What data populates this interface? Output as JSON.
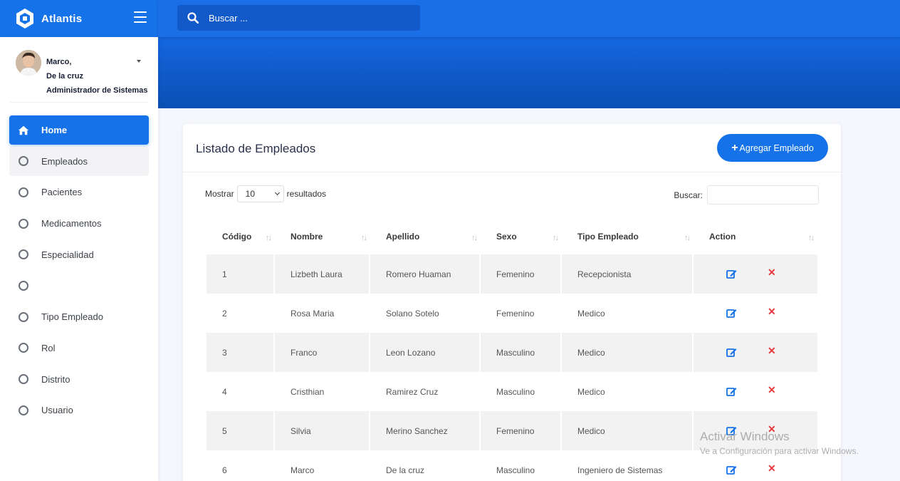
{
  "app": {
    "name": "Atlantis"
  },
  "topbar": {
    "search_placeholder": "Buscar ..."
  },
  "user": {
    "line1": "Marco,",
    "line2": "De la cruz",
    "line3": "Administrador de Sistemas"
  },
  "sidebar": {
    "items": [
      {
        "label": "Home",
        "icon": "home-icon",
        "state": "active"
      },
      {
        "label": "Empleados",
        "icon": "ring-icon",
        "state": "hover"
      },
      {
        "label": "Pacientes",
        "icon": "ring-icon"
      },
      {
        "label": "Medicamentos",
        "icon": "ring-icon"
      },
      {
        "label": "Especialidad",
        "icon": "ring-icon"
      },
      {
        "label": "",
        "icon": "ring-icon"
      },
      {
        "label": "Tipo Empleado",
        "icon": "ring-icon"
      },
      {
        "label": "Rol",
        "icon": "ring-icon"
      },
      {
        "label": "Distrito",
        "icon": "ring-icon"
      },
      {
        "label": "Usuario",
        "icon": "ring-icon"
      }
    ]
  },
  "card": {
    "title": "Listado de Empleados",
    "add_label": "Agregar Empleado",
    "show_label": "Mostrar",
    "page_size": "10",
    "results_label": "resultados",
    "search_label": "Buscar:"
  },
  "table": {
    "headers": [
      "Código",
      "Nombre",
      "Apellido",
      "Sexo",
      "Tipo Empleado",
      "Action"
    ],
    "rows": [
      [
        "1",
        "Lizbeth Laura",
        "Romero Huaman",
        "Femenino",
        "Recepcionista"
      ],
      [
        "2",
        "Rosa Maria",
        "Solano Sotelo",
        "Femenino",
        "Medico"
      ],
      [
        "3",
        "Franco",
        "Leon Lozano",
        "Masculino",
        "Medico"
      ],
      [
        "4",
        "Cristhian",
        "Ramirez Cruz",
        "Masculino",
        "Medico"
      ],
      [
        "5",
        "Silvia",
        "Merino Sanchez",
        "Femenino",
        "Medico"
      ],
      [
        "6",
        "Marco",
        "De la cruz",
        "Masculino",
        "Ingeniero de Sistemas"
      ]
    ]
  },
  "watermark": {
    "title": "Activar Windows",
    "subtitle": "Ve a Configuración para activar Windows."
  },
  "colors": {
    "primary": "#1572e8",
    "danger": "#e8383d"
  }
}
